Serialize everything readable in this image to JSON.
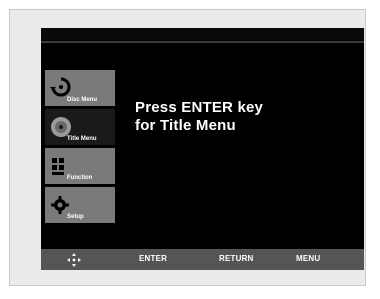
{
  "menu": {
    "items": [
      {
        "label": "Disc Menu",
        "icon": "disc-menu-icon",
        "active": true
      },
      {
        "label": "Title Menu",
        "icon": "title-menu-icon",
        "active": false
      },
      {
        "label": "Function",
        "icon": "function-icon",
        "active": true
      },
      {
        "label": "Setup",
        "icon": "setup-gear-icon",
        "active": true
      }
    ]
  },
  "message": {
    "line1": "Press ENTER key",
    "line2": "for Title Menu"
  },
  "footer": {
    "nav_icon": "navigation-arrows-icon",
    "enter": "ENTER",
    "return": "RETURN",
    "menu": "MENU"
  },
  "colors": {
    "screen_bg": "#000000",
    "footer_bg": "#555555",
    "active_item": "#7a7a7a",
    "text": "#ffffff"
  }
}
